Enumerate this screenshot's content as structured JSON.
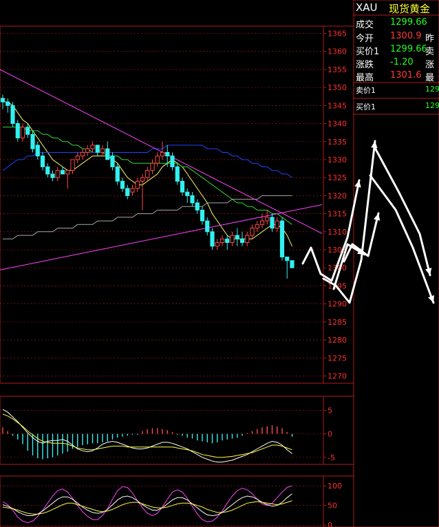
{
  "quote_panel": {
    "symbol": "XAU",
    "name": "现货黄金",
    "rows": [
      {
        "label": "成交",
        "value": "1299.66",
        "value_color": "#22ff22",
        "extra": ""
      },
      {
        "label": "今开",
        "value": "1300.9",
        "value_color": "#ff3b3b",
        "extra": "昨"
      },
      {
        "label": "买价1",
        "value": "1299.66",
        "value_color": "#22ff22",
        "extra": "卖"
      },
      {
        "label": "涨跌",
        "value": "-1.20",
        "value_color": "#22ff22",
        "extra": "涨"
      },
      {
        "label": "最高",
        "value": "1301.6",
        "value_color": "#ff3b3b",
        "extra": "最"
      }
    ],
    "ask_label": "卖价1",
    "ask_value": "129",
    "bid_label": "买价1",
    "bid_value": "129"
  },
  "colors": {
    "background": "#000000",
    "frame": "#b01c1c",
    "axis_text": "#ff3030",
    "up_candle": "#ff4a4a",
    "down_candle": "#33f0f0",
    "ma_short": "#ffff66",
    "ma_mid": "#33dd33",
    "ma_long": "#2244ff",
    "ma_very_long": "#aaaaaa",
    "trendline": "#ff44ff",
    "macd_dif": "#ffffff",
    "macd_dea": "#ffff44",
    "kdj_k": "#ffffff",
    "kdj_d": "#ffff44",
    "kdj_j": "#ff44ff",
    "annotation": "#ffffff"
  },
  "chart_data": [
    {
      "type": "candlestick",
      "panel": "price",
      "ylim": [
        1268,
        1367
      ],
      "y_ticks": [
        1365,
        1360,
        1355,
        1350,
        1345,
        1340,
        1335,
        1330,
        1325,
        1320,
        1315,
        1310,
        1305,
        1300,
        1295,
        1290,
        1285,
        1280,
        1275,
        1270
      ],
      "grid": true,
      "ohlc": [
        [
          1347,
          1348,
          1344,
          1346
        ],
        [
          1346,
          1347,
          1343,
          1345
        ],
        [
          1345,
          1346,
          1339,
          1340
        ],
        [
          1340,
          1341,
          1335,
          1336
        ],
        [
          1336,
          1340,
          1335,
          1339
        ],
        [
          1339,
          1340,
          1336,
          1337
        ],
        [
          1337,
          1338,
          1332,
          1333
        ],
        [
          1334,
          1335,
          1330,
          1331
        ],
        [
          1331,
          1332,
          1327,
          1328
        ],
        [
          1328,
          1329,
          1325,
          1326
        ],
        [
          1326,
          1327,
          1324,
          1325
        ],
        [
          1325,
          1328,
          1324,
          1327
        ],
        [
          1327,
          1328,
          1326,
          1326
        ],
        [
          1326,
          1327,
          1322,
          1327
        ],
        [
          1327,
          1330,
          1326,
          1330
        ],
        [
          1330,
          1332,
          1329,
          1331
        ],
        [
          1331,
          1333,
          1330,
          1332
        ],
        [
          1332,
          1334,
          1331,
          1333
        ],
        [
          1333,
          1335,
          1332,
          1334
        ],
        [
          1334,
          1334,
          1331,
          1332
        ],
        [
          1332,
          1334,
          1331,
          1333
        ],
        [
          1333,
          1335,
          1330,
          1330
        ],
        [
          1331,
          1332,
          1327,
          1328
        ],
        [
          1328,
          1329,
          1323,
          1324
        ],
        [
          1324,
          1325,
          1321,
          1322
        ],
        [
          1322,
          1323,
          1319,
          1320
        ],
        [
          1321,
          1323,
          1320,
          1322
        ],
        [
          1322,
          1325,
          1321,
          1324
        ],
        [
          1324,
          1326,
          1316,
          1325
        ],
        [
          1325,
          1328,
          1324,
          1327
        ],
        [
          1327,
          1330,
          1326,
          1329
        ],
        [
          1329,
          1332,
          1328,
          1331
        ],
        [
          1331,
          1335,
          1330,
          1332
        ],
        [
          1332,
          1334,
          1328,
          1331
        ],
        [
          1331,
          1332,
          1327,
          1328
        ],
        [
          1328,
          1329,
          1323,
          1324
        ],
        [
          1324,
          1325,
          1320,
          1321
        ],
        [
          1321,
          1322,
          1318,
          1320
        ],
        [
          1320,
          1321,
          1317,
          1318
        ],
        [
          1318,
          1319,
          1315,
          1316
        ],
        [
          1316,
          1317,
          1312,
          1313
        ],
        [
          1313,
          1314,
          1309,
          1310
        ],
        [
          1310,
          1311,
          1305,
          1306
        ],
        [
          1306,
          1308,
          1305,
          1307
        ],
        [
          1307,
          1309,
          1306,
          1308
        ],
        [
          1308,
          1309,
          1305,
          1307
        ],
        [
          1307,
          1310,
          1306,
          1309
        ],
        [
          1309,
          1311,
          1306,
          1308
        ],
        [
          1308,
          1310,
          1306,
          1307
        ],
        [
          1307,
          1310,
          1306,
          1309
        ],
        [
          1309,
          1312,
          1308,
          1311
        ],
        [
          1311,
          1313,
          1310,
          1312
        ],
        [
          1312,
          1315,
          1311,
          1313
        ],
        [
          1313,
          1316,
          1312,
          1314
        ],
        [
          1314,
          1315,
          1310,
          1311
        ],
        [
          1311,
          1314,
          1310,
          1313
        ],
        [
          1313,
          1314,
          1302,
          1303
        ],
        [
          1303,
          1303,
          1297,
          1302
        ],
        [
          1302,
          1302,
          1300,
          1300
        ]
      ],
      "ma_series": [
        {
          "key": "ma_short",
          "values": [
            1346,
            1346,
            1345,
            1343,
            1341,
            1340,
            1338,
            1336,
            1334,
            1332,
            1330,
            1329,
            1328,
            1327,
            1327,
            1328,
            1329,
            1330,
            1331,
            1331,
            1331,
            1331,
            1330,
            1329,
            1327,
            1325,
            1324,
            1323,
            1323,
            1324,
            1325,
            1326,
            1328,
            1329,
            1330,
            1329,
            1328,
            1326,
            1324,
            1322,
            1320,
            1318,
            1315,
            1313,
            1311,
            1309,
            1308,
            1308,
            1308,
            1308,
            1308,
            1309,
            1310,
            1311,
            1312,
            1312,
            1311,
            1309,
            1306
          ]
        },
        {
          "key": "ma_mid",
          "values": [
            1339,
            1339,
            1339,
            1339,
            1339,
            1338,
            1338,
            1338,
            1337,
            1337,
            1336,
            1336,
            1335,
            1335,
            1334,
            1334,
            1333,
            1333,
            1332,
            1332,
            1332,
            1331,
            1331,
            1331,
            1330,
            1330,
            1329,
            1329,
            1329,
            1329,
            1329,
            1329,
            1329,
            1329,
            1329,
            1329,
            1328,
            1328,
            1327,
            1326,
            1325,
            1324,
            1323,
            1322,
            1321,
            1320,
            1319,
            1318,
            1318,
            1317,
            1317,
            1316,
            1316,
            1316,
            1315,
            1315,
            1314,
            1313,
            1312
          ]
        },
        {
          "key": "ma_long",
          "values": [
            1327,
            1328,
            1329,
            1330,
            1330,
            1331,
            1331,
            1332,
            1332,
            1332,
            1332,
            1332,
            1332,
            1332,
            1332,
            1332,
            1332,
            1332,
            1332,
            1332,
            1332,
            1332,
            1332,
            1332,
            1332,
            1332,
            1332,
            1332,
            1332,
            1332,
            1333,
            1333,
            1333,
            1334,
            1334,
            1334,
            1334,
            1334,
            1334,
            1334,
            1334,
            1333,
            1333,
            1333,
            1332,
            1332,
            1331,
            1331,
            1330,
            1330,
            1329,
            1329,
            1328,
            1328,
            1327,
            1327,
            1326,
            1326,
            1325
          ]
        },
        {
          "key": "ma_very_long",
          "values": [
            1308,
            1308,
            1308,
            1309,
            1309,
            1309,
            1309,
            1310,
            1310,
            1310,
            1310,
            1311,
            1311,
            1311,
            1311,
            1312,
            1312,
            1312,
            1312,
            1313,
            1313,
            1313,
            1313,
            1314,
            1314,
            1314,
            1314,
            1315,
            1315,
            1315,
            1315,
            1316,
            1316,
            1316,
            1316,
            1316,
            1317,
            1317,
            1317,
            1317,
            1317,
            1318,
            1318,
            1318,
            1318,
            1318,
            1319,
            1319,
            1319,
            1319,
            1319,
            1319,
            1320,
            1320,
            1320,
            1320,
            1320,
            1320,
            1320
          ]
        }
      ],
      "trendlines": [
        {
          "from": [
            -2,
            1356
          ],
          "to": [
            64,
            1309.5
          ]
        },
        {
          "from": [
            -2,
            1299
          ],
          "to": [
            64,
            1317.5
          ]
        }
      ]
    },
    {
      "type": "bar",
      "panel": "macd",
      "ylim": [
        -6.5,
        8
      ],
      "y_ticks": [
        5,
        0,
        -5
      ],
      "histogram": [
        1.4,
        0.6,
        -0.4,
        -1.2,
        -2.2,
        -3.6,
        -4.6,
        -5.2,
        -5.4,
        -5.2,
        -5.0,
        -4.6,
        -4.2,
        -3.8,
        -3.2,
        -2.8,
        -2.4,
        -2.2,
        -2.0,
        -2.0,
        -1.8,
        -1.6,
        -1.2,
        -0.8,
        -0.6,
        -0.4,
        -0.2,
        -0.2,
        0.6,
        1.0,
        1.2,
        1.2,
        1.0,
        0.8,
        0.4,
        -0.2,
        -0.4,
        -0.8,
        -1.0,
        -1.4,
        -1.6,
        -1.8,
        -2.0,
        -1.8,
        -1.4,
        -1.2,
        -1.0,
        -0.8,
        -0.4,
        0.2,
        0.6,
        1.0,
        1.4,
        1.6,
        1.8,
        1.6,
        1.2,
        0.4,
        -0.6
      ],
      "dif": [
        5.2,
        4.6,
        3.6,
        2.6,
        1.4,
        0.2,
        -0.8,
        -1.6,
        -2.0,
        -1.6,
        -1.4,
        -1.4,
        -1.2,
        -1.6,
        -2.4,
        -3.2,
        -3.6,
        -3.8,
        -3.6,
        -3.0,
        -2.2,
        -1.8,
        -1.6,
        -1.8,
        -2.2,
        -2.6,
        -3.0,
        -3.2,
        -3.2,
        -3.0,
        -2.6,
        -2.2,
        -1.8,
        -1.8,
        -2.0,
        -2.4,
        -2.8,
        -3.2,
        -3.8,
        -4.4,
        -5.0,
        -5.4,
        -5.8,
        -6.0,
        -6.0,
        -5.8,
        -5.6,
        -5.2,
        -4.8,
        -4.4,
        -3.8,
        -3.2,
        -2.6,
        -2.0,
        -1.6,
        -1.8,
        -2.4,
        -3.4,
        -4.2
      ],
      "dea": [
        4.2,
        3.8,
        3.2,
        2.4,
        1.6,
        0.6,
        -0.2,
        -1.0,
        -1.6,
        -1.8,
        -2.0,
        -2.0,
        -2.0,
        -2.2,
        -2.6,
        -3.0,
        -3.2,
        -3.4,
        -3.4,
        -3.2,
        -3.0,
        -2.8,
        -2.6,
        -2.6,
        -2.6,
        -2.8,
        -2.8,
        -2.8,
        -2.8,
        -2.8,
        -2.8,
        -2.8,
        -2.8,
        -2.8,
        -2.8,
        -3.0,
        -3.2,
        -3.4,
        -3.6,
        -4.0,
        -4.4,
        -4.6,
        -4.8,
        -5.0,
        -5.0,
        -4.9,
        -4.8,
        -4.6,
        -4.4,
        -4.2,
        -4.0,
        -3.6,
        -3.2,
        -2.8,
        -2.4,
        -2.4,
        -2.6,
        -3.0,
        -3.4
      ]
    },
    {
      "type": "line",
      "panel": "kdj",
      "ylim": [
        -5,
        125
      ],
      "y_ticks": [
        100,
        50,
        0
      ],
      "series": [
        {
          "key": "kdj_j",
          "values": [
            60,
            52,
            38,
            20,
            10,
            6,
            10,
            22,
            38,
            56,
            74,
            88,
            92,
            84,
            68,
            50,
            34,
            22,
            14,
            14,
            24,
            42,
            66,
            88,
            98,
            96,
            82,
            62,
            44,
            30,
            24,
            30,
            46,
            66,
            84,
            90,
            84,
            68,
            48,
            28,
            14,
            8,
            10,
            20,
            36,
            56,
            74,
            88,
            94,
            90,
            80,
            66,
            54,
            50,
            56,
            70,
            84,
            96,
            100
          ]
        },
        {
          "key": "kdj_k",
          "values": [
            52,
            48,
            42,
            34,
            28,
            24,
            24,
            28,
            36,
            46,
            56,
            66,
            72,
            72,
            66,
            56,
            46,
            38,
            32,
            30,
            32,
            40,
            52,
            64,
            72,
            74,
            70,
            62,
            52,
            44,
            38,
            38,
            44,
            54,
            64,
            70,
            70,
            64,
            54,
            44,
            34,
            26,
            24,
            26,
            32,
            42,
            52,
            62,
            70,
            74,
            72,
            66,
            58,
            52,
            48,
            50,
            58,
            70,
            80
          ]
        },
        {
          "key": "kdj_d",
          "values": [
            46,
            44,
            42,
            38,
            34,
            30,
            28,
            28,
            30,
            34,
            40,
            46,
            52,
            56,
            56,
            52,
            48,
            44,
            40,
            36,
            34,
            36,
            40,
            46,
            52,
            56,
            58,
            58,
            54,
            50,
            46,
            44,
            44,
            46,
            50,
            54,
            56,
            56,
            54,
            50,
            46,
            40,
            36,
            32,
            32,
            34,
            38,
            44,
            50,
            56,
            58,
            60,
            58,
            56,
            54,
            52,
            54,
            58,
            62
          ]
        }
      ]
    }
  ]
}
